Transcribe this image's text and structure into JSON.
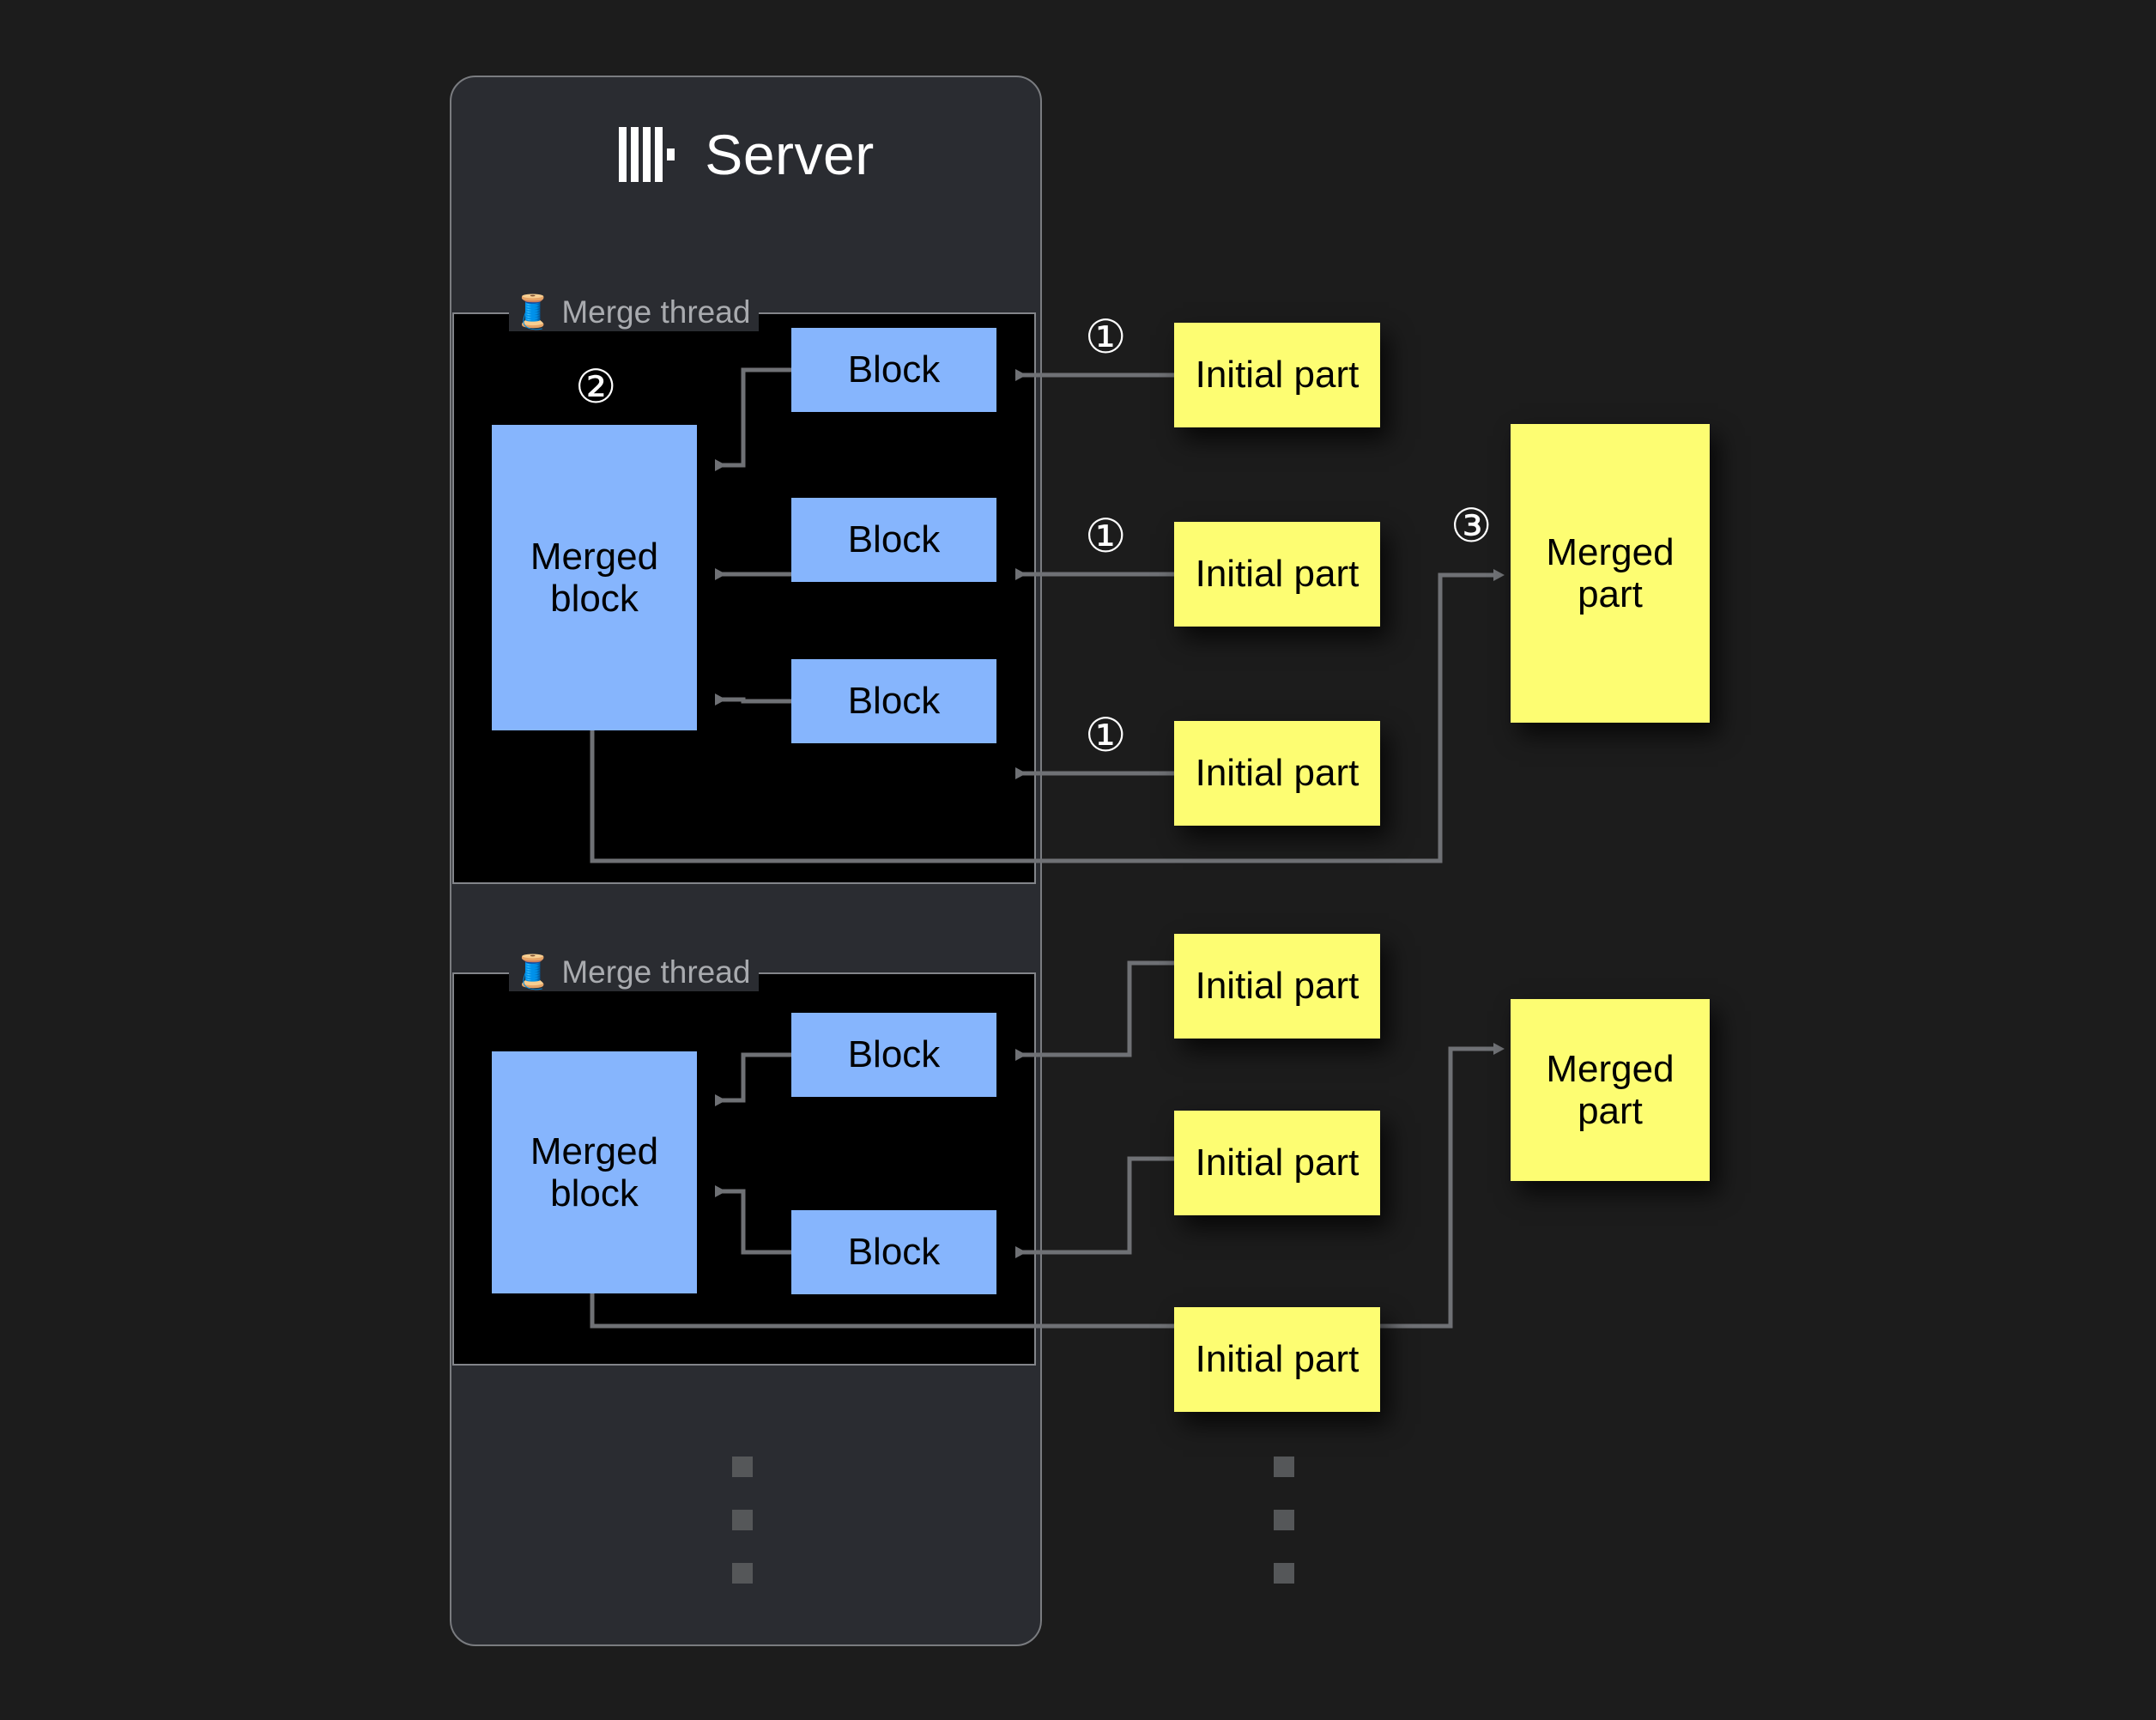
{
  "server": {
    "title": "Server",
    "logo_icon": "clickhouse-logo-icon"
  },
  "merge_threads": [
    {
      "label": "Merge thread",
      "icon": "thread-spool-icon",
      "merged_block_label": "Merged block",
      "blocks": [
        "Block",
        "Block",
        "Block"
      ],
      "step_marker": "②"
    },
    {
      "label": "Merge thread",
      "icon": "thread-spool-icon",
      "merged_block_label": "Merged block",
      "blocks": [
        "Block",
        "Block"
      ],
      "step_marker": ""
    }
  ],
  "initial_parts": [
    "Initial part",
    "Initial part",
    "Initial part",
    "Initial part",
    "Initial part",
    "Initial part"
  ],
  "merged_parts": [
    "Merged part",
    "Merged part"
  ],
  "step_markers": {
    "one_a": "①",
    "one_b": "①",
    "one_c": "①",
    "two": "②",
    "three": "③"
  },
  "colors": {
    "background": "#1c1c1c",
    "panel": "#2a2c31",
    "panel_border": "#7a7c80",
    "thread_box": "#000000",
    "block_blue": "#86b5fd",
    "part_yellow": "#fdfd72",
    "wire": "#6f7175",
    "title_text": "#ffffff",
    "label_text": "#a9abaf"
  }
}
